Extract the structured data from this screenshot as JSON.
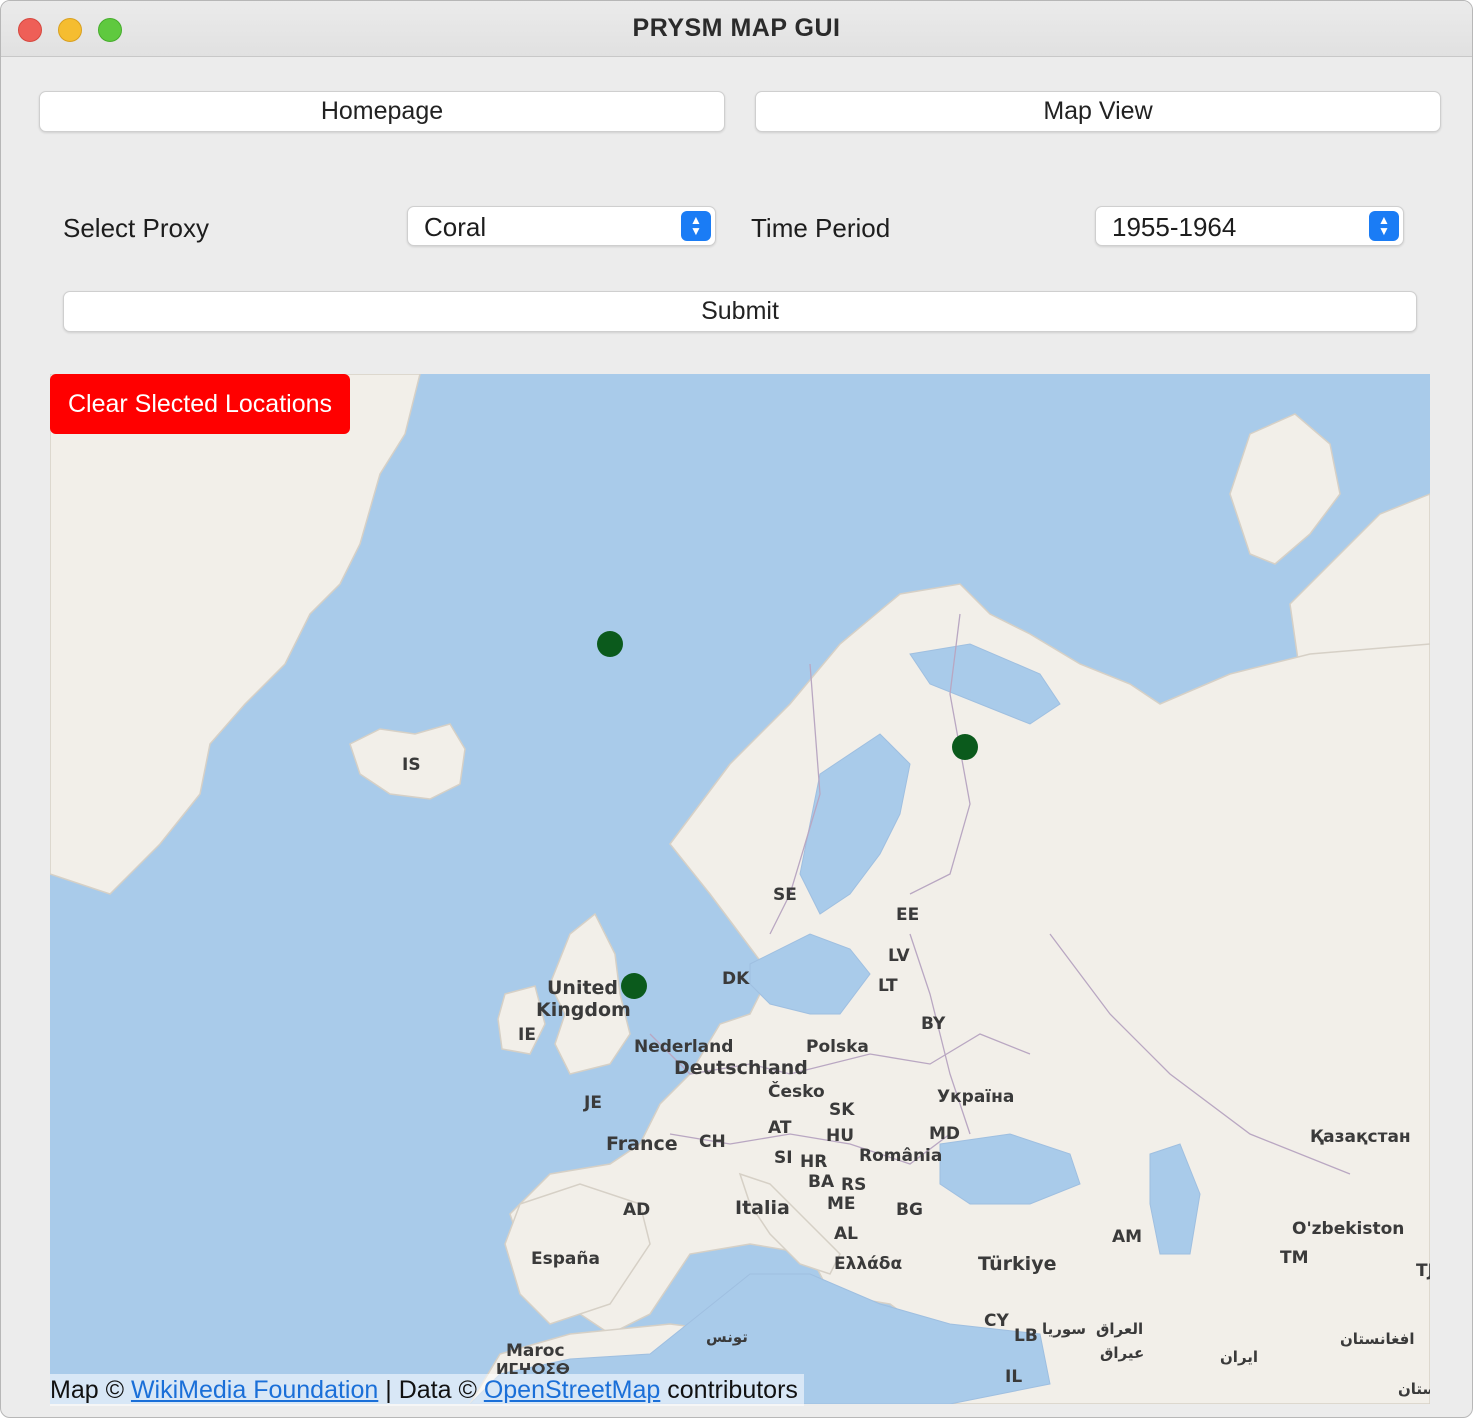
{
  "window": {
    "title": "PRYSM MAP GUI"
  },
  "nav": {
    "homepage_label": "Homepage",
    "mapview_label": "Map View"
  },
  "form": {
    "proxy_label": "Select Proxy",
    "proxy_value": "Coral",
    "time_label": "Time Period",
    "time_value": "1955-1964",
    "submit_label": "Submit"
  },
  "map": {
    "clear_label": "Clear Slected Locations",
    "attribution": {
      "prefix": "Map ©",
      "link1": "WikiMedia Foundation",
      "mid": "| Data ©",
      "link2": "OpenStreetMap",
      "suffix": "contributors"
    },
    "place_labels": [
      "IS",
      "SE",
      "EE",
      "LV",
      "LT",
      "DK",
      "United",
      "Kingdom",
      "IE",
      "BY",
      "Nederland",
      "Deutschland",
      "Polska",
      "Česko",
      "SK",
      "Україна",
      "JE",
      "France",
      "CH",
      "AT",
      "HU",
      "MD",
      "SI",
      "HR",
      "România",
      "BA",
      "RS",
      "ME",
      "AD",
      "Italia",
      "BG",
      "AL",
      "España",
      "Ελλάδα",
      "Türkiye",
      "AM",
      "Қазақстан",
      "O'zbekiston",
      "TM",
      "TJ",
      "CY",
      "LB",
      "سوريا",
      "العراق",
      "عيراق",
      "ایران",
      "افغانستان",
      "Maroc",
      "ⵍⵎⵖⵔⵉⴱ",
      "تونس",
      "IL",
      "ستان"
    ],
    "marker_color": "#0b5a1c",
    "water_color": "#a9cbea",
    "land_color": "#f2efe9"
  },
  "colors": {
    "clear_button": "#ff0000",
    "stepper": "#1a7cf5",
    "link": "#1a6fd8"
  }
}
